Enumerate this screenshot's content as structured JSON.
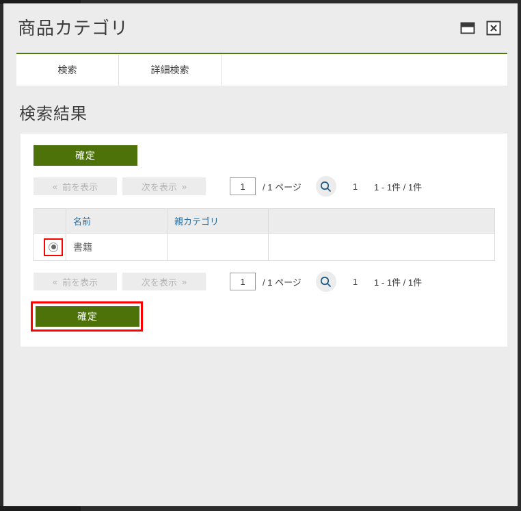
{
  "window": {
    "title": "商品カテゴリ",
    "controls": [
      {
        "name": "restore-window-button",
        "label": "restore-icon"
      },
      {
        "name": "close-window-button",
        "label": "close-icon"
      }
    ]
  },
  "tabs": [
    {
      "label": "検索",
      "active": true
    },
    {
      "label": "詳細検索",
      "active": false
    }
  ],
  "section": {
    "title": "検索結果"
  },
  "buttons": {
    "confirm_top": "確定",
    "confirm_bottom": "確定"
  },
  "pager_top": {
    "prev_label": "前を表示",
    "prev_chevron": "«",
    "next_label": "次を表示",
    "next_chevron": "»",
    "page_value": "1",
    "page_of": "/ 1 ページ",
    "search_icon": "search-icon",
    "page_number": "1",
    "count_text": "1 - 1件 / 1件"
  },
  "pager_bottom": {
    "prev_label": "前を表示",
    "prev_chevron": "«",
    "next_label": "次を表示",
    "next_chevron": "»",
    "page_value": "1",
    "page_of": "/ 1 ページ",
    "search_icon": "search-icon",
    "page_number": "1",
    "count_text": "1 - 1件 / 1件"
  },
  "table": {
    "columns": [
      "",
      "名前",
      "親カテゴリ",
      ""
    ],
    "rows": [
      {
        "selected": true,
        "name": "書籍",
        "parent": "",
        "extra": ""
      }
    ]
  },
  "colors": {
    "accent_green": "#4c7209",
    "tab_top_border": "#4c7a0b",
    "annotation_red": "#ff0000",
    "header_text_blue": "#2d6e9e",
    "row_selected_blue": "#dbe9f7",
    "page_background": "#ececec",
    "frame_dark": "#2b2b2b"
  }
}
